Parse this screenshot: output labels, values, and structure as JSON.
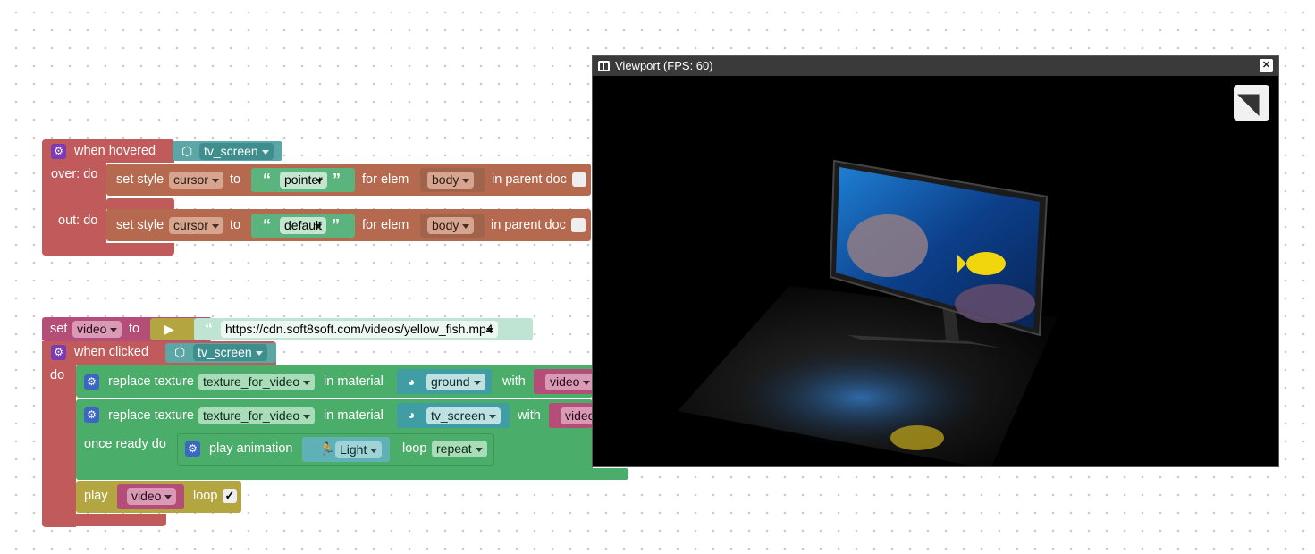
{
  "hover_group": {
    "event_label": "when hovered",
    "object_name": "tv_screen",
    "over_label": "over: do",
    "out_label": "out: do",
    "over_row": {
      "set_style": "set style",
      "property": "cursor",
      "to": "to",
      "value": "pointer",
      "for_elem": "for elem",
      "elem": "body",
      "in_parent": "in parent doc"
    },
    "out_row": {
      "set_style": "set style",
      "property": "cursor",
      "to": "to",
      "value": "default",
      "for_elem": "for elem",
      "elem": "body",
      "in_parent": "in parent doc"
    }
  },
  "click_group": {
    "set_label": "set",
    "var_name": "video",
    "to_label": "to",
    "url": "https://cdn.soft8soft.com/videos/yellow_fish.mp4",
    "event_label": "when clicked",
    "object_name": "tv_screen",
    "do_label": "do",
    "replace1": {
      "label": "replace texture",
      "texture": "texture_for_video",
      "in_material": "in material",
      "material": "ground",
      "with": "with",
      "var": "video"
    },
    "replace2": {
      "label": "replace texture",
      "texture": "texture_for_video",
      "in_material": "in material",
      "material": "tv_screen",
      "with": "with",
      "var": "video"
    },
    "once_ready": "once ready do",
    "play_anim": {
      "label": "play animation",
      "anim": "Light",
      "loop": "loop",
      "mode": "repeat"
    },
    "play_row": {
      "label": "play",
      "var": "video",
      "loop": "loop",
      "loop_checked": "✓"
    }
  },
  "viewport": {
    "title": "Viewport (FPS: 60)",
    "close": "✕",
    "fullscreen": "◥"
  }
}
